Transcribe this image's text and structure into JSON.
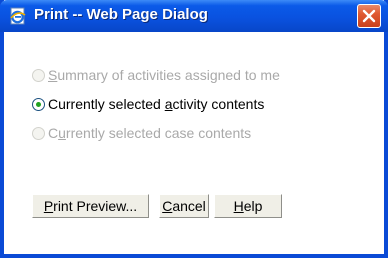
{
  "window": {
    "title": "Print -- Web Page Dialog",
    "title_icon": "ie-page-icon",
    "close_icon": "close-x-icon"
  },
  "options": [
    {
      "pre": "",
      "accel": "S",
      "post": "ummary of activities assigned to me",
      "checked": false,
      "enabled": false
    },
    {
      "pre": "Currently selected ",
      "accel": "a",
      "post": "ctivity contents",
      "checked": true,
      "enabled": true
    },
    {
      "pre": "C",
      "accel": "u",
      "post": "rrently selected case contents",
      "checked": false,
      "enabled": false
    }
  ],
  "buttons": {
    "print_preview": {
      "pre": "",
      "accel": "P",
      "post": "rint Preview..."
    },
    "cancel": {
      "pre": "",
      "accel": "C",
      "post": "ancel"
    },
    "help": {
      "pre": "",
      "accel": "H",
      "post": "elp"
    }
  },
  "colors": {
    "titlebar": "#0a52e0",
    "close_button": "#e05a32",
    "disabled_text": "#a9a9a9",
    "radio_dot": "#21a121"
  }
}
